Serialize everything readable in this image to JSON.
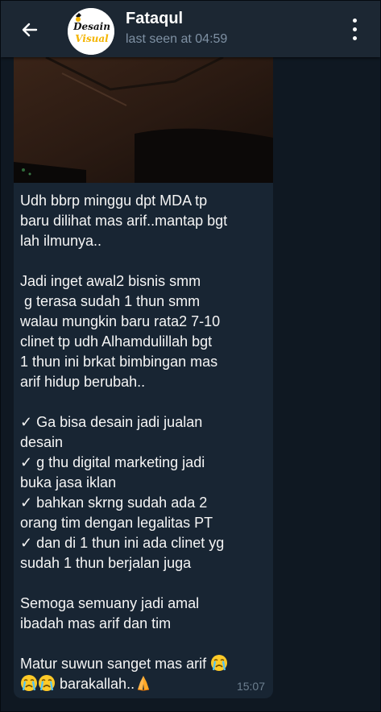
{
  "header": {
    "contact_name": "Fataqul",
    "status": "last seen at 04:59",
    "avatar_text_line1": "Desain",
    "avatar_text_line2": "Visual"
  },
  "message": {
    "lines": [
      "Udh bbrp minggu dpt MDA tp",
      "baru dilihat mas arif..mantap bgt",
      "lah ilmunya..",
      "",
      "Jadi inget awal2 bisnis smm",
      " g terasa sudah 1 thun smm",
      "walau mungkin baru rata2 7-10",
      "clinet tp udh Alhamdulillah bgt",
      "1 thun ini brkat bimbingan mas",
      "arif hidup berubah..",
      "",
      "✓ Ga bisa desain jadi jualan",
      "desain",
      "✓ g thu digital marketing jadi",
      "buka jasa iklan",
      "✓ bahkan skrng sudah ada 2",
      "orang tim dengan legalitas PT",
      "✓ dan di 1 thun ini ada clinet yg",
      "sudah 1 thun berjalan juga",
      "",
      "Semoga semuany jadi amal",
      "ibadah mas arif dan tim",
      "",
      "Matur suwun sanget mas arif"
    ],
    "last_line_text": "barakallah..",
    "time": "15:07",
    "emojis": [
      "crying-face",
      "crying-face",
      "crying-face",
      "folded-hands"
    ]
  },
  "colors": {
    "header_bg": "#1c2733",
    "chat_bg": "#0f1822",
    "bubble_bg": "#182533",
    "status_text": "#7f91a4"
  }
}
